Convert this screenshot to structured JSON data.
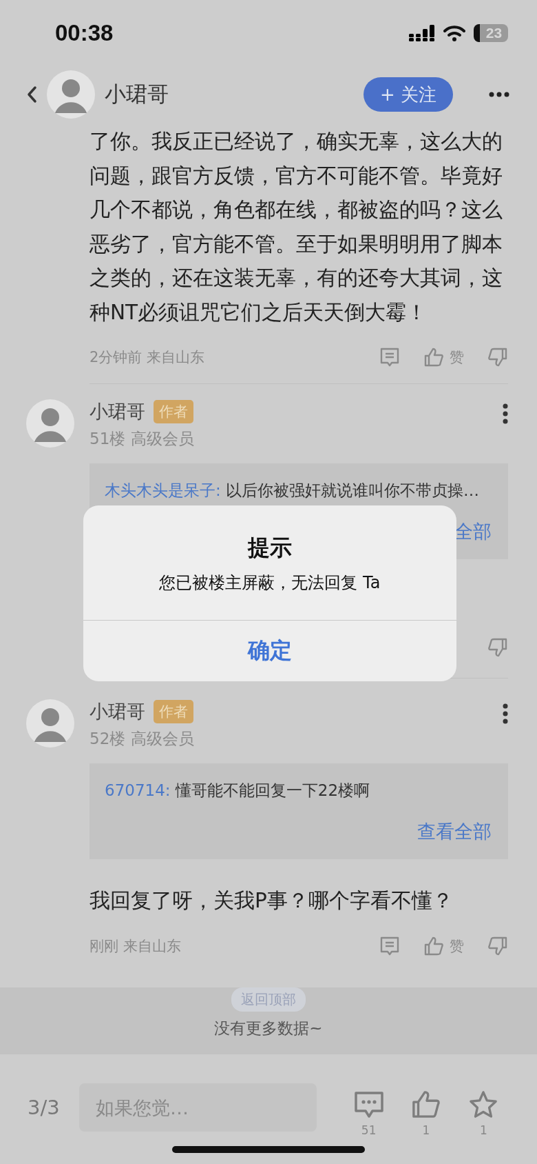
{
  "status_bar": {
    "time": "00:38",
    "battery": "23"
  },
  "header": {
    "author": "小珺哥",
    "follow_button": "+ 关注"
  },
  "post": {
    "text": "了你。我反正已经说了，确实无辜，这么大的问题，跟官方反馈，官方不可能不管。毕竟好几个不都说，角色都在线，都被盗的吗？这么恶劣了，官方能不管。至于如果明明用了脚本之类的，还在这装无辜，有的还夸大其词，这种NT必须诅咒它们之后天天倒大霉！",
    "time": "2分钟前",
    "location": "来自山东",
    "like_label": "赞"
  },
  "comments": [
    {
      "author": "小珺哥",
      "badge": "作者",
      "floor": "51楼",
      "rank": "高级会员",
      "quote": {
        "user": "木头木头是呆子:",
        "text": "以后你被强奸就说谁叫你不带贞操…",
        "more": "全部"
      }
    },
    {
      "author": "小珺哥",
      "badge": "作者",
      "floor": "52楼",
      "rank": "高级会员",
      "quote": {
        "user": "670714:",
        "text": "懂哥能不能回复一下22楼啊",
        "more": "查看全部"
      },
      "body": "我回复了呀，关我P事？哪个字看不懂？",
      "time": "刚刚",
      "location": "来自山东",
      "like_label": "赞"
    }
  ],
  "footer": {
    "back_to_top": "返回顶部",
    "no_more": "没有更多数据~"
  },
  "bottom_bar": {
    "page": "3/3",
    "placeholder": "如果您觉…",
    "comments": "51",
    "likes": "1",
    "favorites": "1"
  },
  "dialog": {
    "title": "提示",
    "message": "您已被楼主屏蔽，无法回复 Ta",
    "confirm": "确定"
  }
}
